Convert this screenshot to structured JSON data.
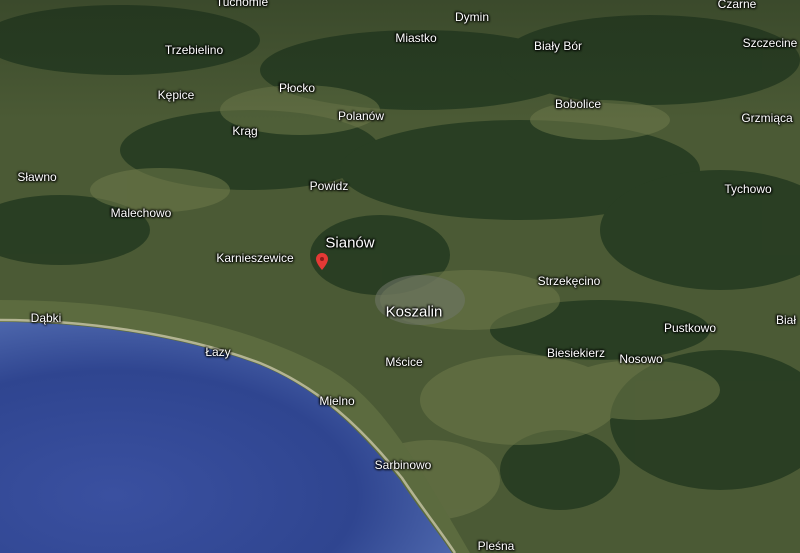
{
  "map": {
    "view": "satellite-3d",
    "water_color": "#4058a8",
    "land_color": "#4b5a35",
    "forest_color": "#243a20",
    "pin_color": "#e53935",
    "places": [
      {
        "id": "tuchomie",
        "name": "Tuchomie"
      },
      {
        "id": "czarne",
        "name": "Czarne"
      },
      {
        "id": "dymin",
        "name": "Dymin"
      },
      {
        "id": "trzebielino",
        "name": "Trzebielino"
      },
      {
        "id": "miastko",
        "name": "Miastko"
      },
      {
        "id": "bialy-bor",
        "name": "Biały Bór"
      },
      {
        "id": "szczecinek",
        "name": "Szczecine"
      },
      {
        "id": "kepice",
        "name": "Kępice"
      },
      {
        "id": "plocko",
        "name": "Płocko"
      },
      {
        "id": "bobolice",
        "name": "Bobolice"
      },
      {
        "id": "polanow",
        "name": "Polanów"
      },
      {
        "id": "grzmiaca",
        "name": "Grzmiąca"
      },
      {
        "id": "krag",
        "name": "Krąg"
      },
      {
        "id": "slawno",
        "name": "Sławno"
      },
      {
        "id": "powidz",
        "name": "Powidz"
      },
      {
        "id": "tychowo",
        "name": "Tychowo"
      },
      {
        "id": "malechowo",
        "name": "Malechowo"
      },
      {
        "id": "sianow",
        "name": "Sianów"
      },
      {
        "id": "karnieszewice",
        "name": "Karnieszewice"
      },
      {
        "id": "strzekecino",
        "name": "Strzekęcino"
      },
      {
        "id": "koszalin",
        "name": "Koszalin"
      },
      {
        "id": "dabki",
        "name": "Dąbki"
      },
      {
        "id": "bialogard",
        "name": "Biał"
      },
      {
        "id": "pustkowo",
        "name": "Pustkowo"
      },
      {
        "id": "lazy",
        "name": "Łazy"
      },
      {
        "id": "biesiekierz",
        "name": "Biesiekierz"
      },
      {
        "id": "nosowo",
        "name": "Nosowo"
      },
      {
        "id": "mscice",
        "name": "Mścice"
      },
      {
        "id": "mielno",
        "name": "Mielno"
      },
      {
        "id": "sarbinowo",
        "name": "Sarbinowo"
      },
      {
        "id": "plesna",
        "name": "Pleśna"
      }
    ]
  }
}
